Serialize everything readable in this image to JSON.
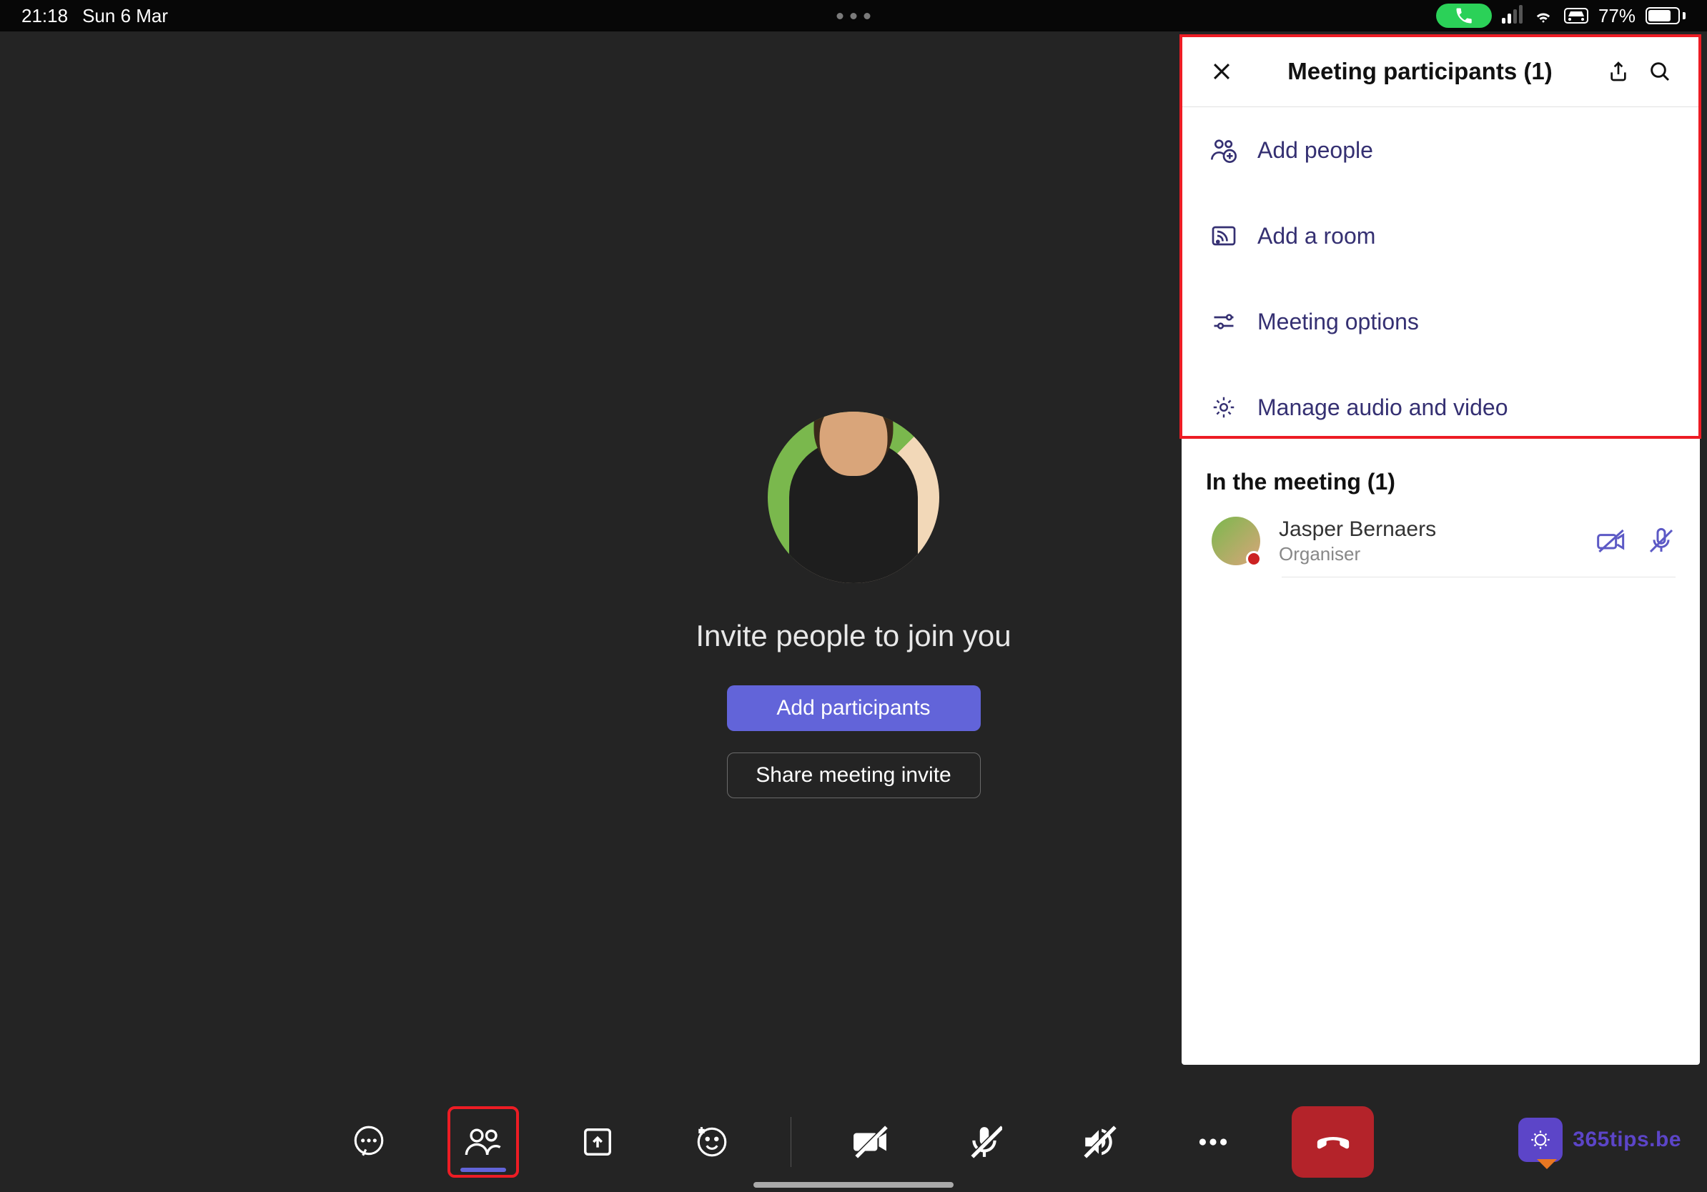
{
  "statusbar": {
    "time": "21:18",
    "date": "Sun 6 Mar",
    "battery_pct": "77%"
  },
  "main": {
    "invite_title": "Invite people to join you",
    "add_participants_btn": "Add participants",
    "share_invite_btn": "Share meeting invite"
  },
  "panel": {
    "title": "Meeting participants (1)",
    "options": {
      "add_people": "Add people",
      "add_room": "Add a room",
      "meeting_options": "Meeting options",
      "manage_av": "Manage audio and video"
    },
    "section_in_meeting": "In the meeting (1)",
    "participant": {
      "name": "Jasper Bernaers",
      "role": "Organiser"
    }
  },
  "watermark": "365tips.be"
}
